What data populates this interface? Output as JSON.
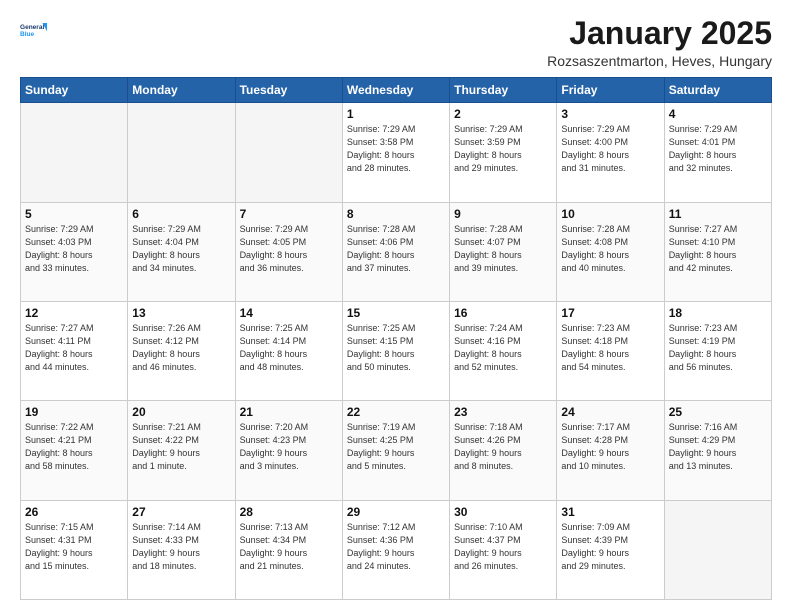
{
  "logo": {
    "line1": "General",
    "line2": "Blue"
  },
  "title": "January 2025",
  "location": "Rozsaszentmarton, Heves, Hungary",
  "days_header": [
    "Sunday",
    "Monday",
    "Tuesday",
    "Wednesday",
    "Thursday",
    "Friday",
    "Saturday"
  ],
  "weeks": [
    [
      {
        "day": "",
        "detail": ""
      },
      {
        "day": "",
        "detail": ""
      },
      {
        "day": "",
        "detail": ""
      },
      {
        "day": "1",
        "detail": "Sunrise: 7:29 AM\nSunset: 3:58 PM\nDaylight: 8 hours\nand 28 minutes."
      },
      {
        "day": "2",
        "detail": "Sunrise: 7:29 AM\nSunset: 3:59 PM\nDaylight: 8 hours\nand 29 minutes."
      },
      {
        "day": "3",
        "detail": "Sunrise: 7:29 AM\nSunset: 4:00 PM\nDaylight: 8 hours\nand 31 minutes."
      },
      {
        "day": "4",
        "detail": "Sunrise: 7:29 AM\nSunset: 4:01 PM\nDaylight: 8 hours\nand 32 minutes."
      }
    ],
    [
      {
        "day": "5",
        "detail": "Sunrise: 7:29 AM\nSunset: 4:03 PM\nDaylight: 8 hours\nand 33 minutes."
      },
      {
        "day": "6",
        "detail": "Sunrise: 7:29 AM\nSunset: 4:04 PM\nDaylight: 8 hours\nand 34 minutes."
      },
      {
        "day": "7",
        "detail": "Sunrise: 7:29 AM\nSunset: 4:05 PM\nDaylight: 8 hours\nand 36 minutes."
      },
      {
        "day": "8",
        "detail": "Sunrise: 7:28 AM\nSunset: 4:06 PM\nDaylight: 8 hours\nand 37 minutes."
      },
      {
        "day": "9",
        "detail": "Sunrise: 7:28 AM\nSunset: 4:07 PM\nDaylight: 8 hours\nand 39 minutes."
      },
      {
        "day": "10",
        "detail": "Sunrise: 7:28 AM\nSunset: 4:08 PM\nDaylight: 8 hours\nand 40 minutes."
      },
      {
        "day": "11",
        "detail": "Sunrise: 7:27 AM\nSunset: 4:10 PM\nDaylight: 8 hours\nand 42 minutes."
      }
    ],
    [
      {
        "day": "12",
        "detail": "Sunrise: 7:27 AM\nSunset: 4:11 PM\nDaylight: 8 hours\nand 44 minutes."
      },
      {
        "day": "13",
        "detail": "Sunrise: 7:26 AM\nSunset: 4:12 PM\nDaylight: 8 hours\nand 46 minutes."
      },
      {
        "day": "14",
        "detail": "Sunrise: 7:25 AM\nSunset: 4:14 PM\nDaylight: 8 hours\nand 48 minutes."
      },
      {
        "day": "15",
        "detail": "Sunrise: 7:25 AM\nSunset: 4:15 PM\nDaylight: 8 hours\nand 50 minutes."
      },
      {
        "day": "16",
        "detail": "Sunrise: 7:24 AM\nSunset: 4:16 PM\nDaylight: 8 hours\nand 52 minutes."
      },
      {
        "day": "17",
        "detail": "Sunrise: 7:23 AM\nSunset: 4:18 PM\nDaylight: 8 hours\nand 54 minutes."
      },
      {
        "day": "18",
        "detail": "Sunrise: 7:23 AM\nSunset: 4:19 PM\nDaylight: 8 hours\nand 56 minutes."
      }
    ],
    [
      {
        "day": "19",
        "detail": "Sunrise: 7:22 AM\nSunset: 4:21 PM\nDaylight: 8 hours\nand 58 minutes."
      },
      {
        "day": "20",
        "detail": "Sunrise: 7:21 AM\nSunset: 4:22 PM\nDaylight: 9 hours\nand 1 minute."
      },
      {
        "day": "21",
        "detail": "Sunrise: 7:20 AM\nSunset: 4:23 PM\nDaylight: 9 hours\nand 3 minutes."
      },
      {
        "day": "22",
        "detail": "Sunrise: 7:19 AM\nSunset: 4:25 PM\nDaylight: 9 hours\nand 5 minutes."
      },
      {
        "day": "23",
        "detail": "Sunrise: 7:18 AM\nSunset: 4:26 PM\nDaylight: 9 hours\nand 8 minutes."
      },
      {
        "day": "24",
        "detail": "Sunrise: 7:17 AM\nSunset: 4:28 PM\nDaylight: 9 hours\nand 10 minutes."
      },
      {
        "day": "25",
        "detail": "Sunrise: 7:16 AM\nSunset: 4:29 PM\nDaylight: 9 hours\nand 13 minutes."
      }
    ],
    [
      {
        "day": "26",
        "detail": "Sunrise: 7:15 AM\nSunset: 4:31 PM\nDaylight: 9 hours\nand 15 minutes."
      },
      {
        "day": "27",
        "detail": "Sunrise: 7:14 AM\nSunset: 4:33 PM\nDaylight: 9 hours\nand 18 minutes."
      },
      {
        "day": "28",
        "detail": "Sunrise: 7:13 AM\nSunset: 4:34 PM\nDaylight: 9 hours\nand 21 minutes."
      },
      {
        "day": "29",
        "detail": "Sunrise: 7:12 AM\nSunset: 4:36 PM\nDaylight: 9 hours\nand 24 minutes."
      },
      {
        "day": "30",
        "detail": "Sunrise: 7:10 AM\nSunset: 4:37 PM\nDaylight: 9 hours\nand 26 minutes."
      },
      {
        "day": "31",
        "detail": "Sunrise: 7:09 AM\nSunset: 4:39 PM\nDaylight: 9 hours\nand 29 minutes."
      },
      {
        "day": "",
        "detail": ""
      }
    ]
  ]
}
